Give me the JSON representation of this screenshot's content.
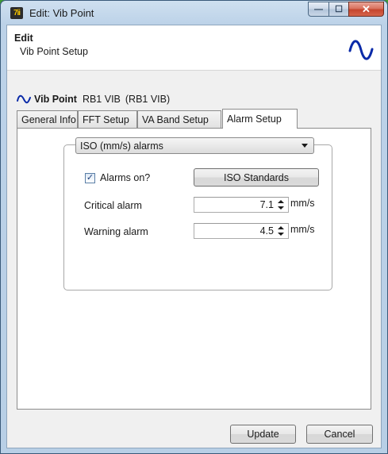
{
  "window": {
    "title": "Edit: Vib Point",
    "app_icon_text": "7ii",
    "controls": {
      "minimize": "—",
      "maximize": "☐",
      "close": "✕"
    }
  },
  "header": {
    "title": "Edit",
    "subtitle": "Vib Point Setup",
    "icon": "sine-wave-icon"
  },
  "point": {
    "icon": "sine-wave-icon",
    "name": "Vib Point",
    "id": "RB1 VIB",
    "id_paren": "(RB1 VIB)"
  },
  "tabs": [
    {
      "label": "General Info"
    },
    {
      "label": "FFT Setup"
    },
    {
      "label": "VA Band Setup"
    },
    {
      "label": "Alarm Setup",
      "active": true
    }
  ],
  "alarm_setup": {
    "mode_selected": "ISO (mm/s) alarms",
    "alarms_on_label": "Alarms on?",
    "alarms_on_checked": true,
    "check_glyph": "✓",
    "iso_button_label": "ISO Standards",
    "critical": {
      "label": "Critical alarm",
      "value": "7.1",
      "unit": "mm/s"
    },
    "warning": {
      "label": "Warning alarm",
      "value": "4.5",
      "unit": "mm/s"
    }
  },
  "footer": {
    "update_label": "Update",
    "cancel_label": "Cancel"
  },
  "colors": {
    "accent": "#0a2aa8",
    "window_frame": "#bcd2e8",
    "close_button": "#c5452e",
    "desktop": "#3f9c33"
  }
}
